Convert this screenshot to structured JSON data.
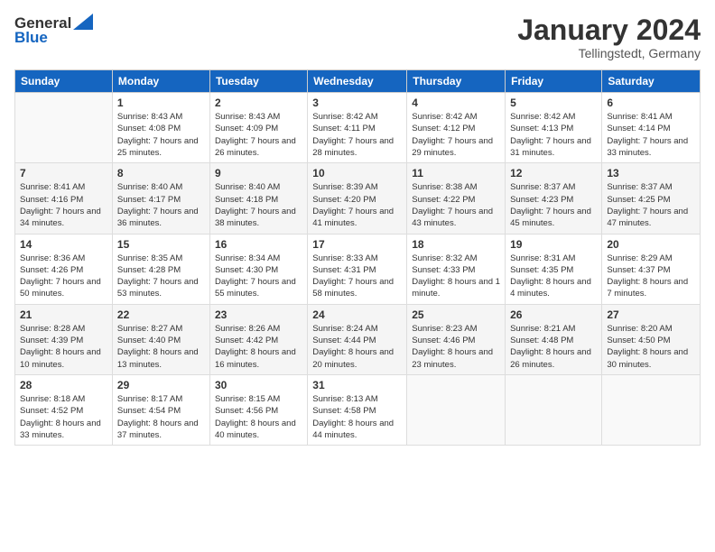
{
  "logo": {
    "general": "General",
    "blue": "Blue"
  },
  "header": {
    "month": "January 2024",
    "location": "Tellingstedt, Germany"
  },
  "days_of_week": [
    "Sunday",
    "Monday",
    "Tuesday",
    "Wednesday",
    "Thursday",
    "Friday",
    "Saturday"
  ],
  "weeks": [
    [
      {
        "day": "",
        "sunrise": "",
        "sunset": "",
        "daylight": ""
      },
      {
        "day": "1",
        "sunrise": "Sunrise: 8:43 AM",
        "sunset": "Sunset: 4:08 PM",
        "daylight": "Daylight: 7 hours and 25 minutes."
      },
      {
        "day": "2",
        "sunrise": "Sunrise: 8:43 AM",
        "sunset": "Sunset: 4:09 PM",
        "daylight": "Daylight: 7 hours and 26 minutes."
      },
      {
        "day": "3",
        "sunrise": "Sunrise: 8:42 AM",
        "sunset": "Sunset: 4:11 PM",
        "daylight": "Daylight: 7 hours and 28 minutes."
      },
      {
        "day": "4",
        "sunrise": "Sunrise: 8:42 AM",
        "sunset": "Sunset: 4:12 PM",
        "daylight": "Daylight: 7 hours and 29 minutes."
      },
      {
        "day": "5",
        "sunrise": "Sunrise: 8:42 AM",
        "sunset": "Sunset: 4:13 PM",
        "daylight": "Daylight: 7 hours and 31 minutes."
      },
      {
        "day": "6",
        "sunrise": "Sunrise: 8:41 AM",
        "sunset": "Sunset: 4:14 PM",
        "daylight": "Daylight: 7 hours and 33 minutes."
      }
    ],
    [
      {
        "day": "7",
        "sunrise": "Sunrise: 8:41 AM",
        "sunset": "Sunset: 4:16 PM",
        "daylight": "Daylight: 7 hours and 34 minutes."
      },
      {
        "day": "8",
        "sunrise": "Sunrise: 8:40 AM",
        "sunset": "Sunset: 4:17 PM",
        "daylight": "Daylight: 7 hours and 36 minutes."
      },
      {
        "day": "9",
        "sunrise": "Sunrise: 8:40 AM",
        "sunset": "Sunset: 4:18 PM",
        "daylight": "Daylight: 7 hours and 38 minutes."
      },
      {
        "day": "10",
        "sunrise": "Sunrise: 8:39 AM",
        "sunset": "Sunset: 4:20 PM",
        "daylight": "Daylight: 7 hours and 41 minutes."
      },
      {
        "day": "11",
        "sunrise": "Sunrise: 8:38 AM",
        "sunset": "Sunset: 4:22 PM",
        "daylight": "Daylight: 7 hours and 43 minutes."
      },
      {
        "day": "12",
        "sunrise": "Sunrise: 8:37 AM",
        "sunset": "Sunset: 4:23 PM",
        "daylight": "Daylight: 7 hours and 45 minutes."
      },
      {
        "day": "13",
        "sunrise": "Sunrise: 8:37 AM",
        "sunset": "Sunset: 4:25 PM",
        "daylight": "Daylight: 7 hours and 47 minutes."
      }
    ],
    [
      {
        "day": "14",
        "sunrise": "Sunrise: 8:36 AM",
        "sunset": "Sunset: 4:26 PM",
        "daylight": "Daylight: 7 hours and 50 minutes."
      },
      {
        "day": "15",
        "sunrise": "Sunrise: 8:35 AM",
        "sunset": "Sunset: 4:28 PM",
        "daylight": "Daylight: 7 hours and 53 minutes."
      },
      {
        "day": "16",
        "sunrise": "Sunrise: 8:34 AM",
        "sunset": "Sunset: 4:30 PM",
        "daylight": "Daylight: 7 hours and 55 minutes."
      },
      {
        "day": "17",
        "sunrise": "Sunrise: 8:33 AM",
        "sunset": "Sunset: 4:31 PM",
        "daylight": "Daylight: 7 hours and 58 minutes."
      },
      {
        "day": "18",
        "sunrise": "Sunrise: 8:32 AM",
        "sunset": "Sunset: 4:33 PM",
        "daylight": "Daylight: 8 hours and 1 minute."
      },
      {
        "day": "19",
        "sunrise": "Sunrise: 8:31 AM",
        "sunset": "Sunset: 4:35 PM",
        "daylight": "Daylight: 8 hours and 4 minutes."
      },
      {
        "day": "20",
        "sunrise": "Sunrise: 8:29 AM",
        "sunset": "Sunset: 4:37 PM",
        "daylight": "Daylight: 8 hours and 7 minutes."
      }
    ],
    [
      {
        "day": "21",
        "sunrise": "Sunrise: 8:28 AM",
        "sunset": "Sunset: 4:39 PM",
        "daylight": "Daylight: 8 hours and 10 minutes."
      },
      {
        "day": "22",
        "sunrise": "Sunrise: 8:27 AM",
        "sunset": "Sunset: 4:40 PM",
        "daylight": "Daylight: 8 hours and 13 minutes."
      },
      {
        "day": "23",
        "sunrise": "Sunrise: 8:26 AM",
        "sunset": "Sunset: 4:42 PM",
        "daylight": "Daylight: 8 hours and 16 minutes."
      },
      {
        "day": "24",
        "sunrise": "Sunrise: 8:24 AM",
        "sunset": "Sunset: 4:44 PM",
        "daylight": "Daylight: 8 hours and 20 minutes."
      },
      {
        "day": "25",
        "sunrise": "Sunrise: 8:23 AM",
        "sunset": "Sunset: 4:46 PM",
        "daylight": "Daylight: 8 hours and 23 minutes."
      },
      {
        "day": "26",
        "sunrise": "Sunrise: 8:21 AM",
        "sunset": "Sunset: 4:48 PM",
        "daylight": "Daylight: 8 hours and 26 minutes."
      },
      {
        "day": "27",
        "sunrise": "Sunrise: 8:20 AM",
        "sunset": "Sunset: 4:50 PM",
        "daylight": "Daylight: 8 hours and 30 minutes."
      }
    ],
    [
      {
        "day": "28",
        "sunrise": "Sunrise: 8:18 AM",
        "sunset": "Sunset: 4:52 PM",
        "daylight": "Daylight: 8 hours and 33 minutes."
      },
      {
        "day": "29",
        "sunrise": "Sunrise: 8:17 AM",
        "sunset": "Sunset: 4:54 PM",
        "daylight": "Daylight: 8 hours and 37 minutes."
      },
      {
        "day": "30",
        "sunrise": "Sunrise: 8:15 AM",
        "sunset": "Sunset: 4:56 PM",
        "daylight": "Daylight: 8 hours and 40 minutes."
      },
      {
        "day": "31",
        "sunrise": "Sunrise: 8:13 AM",
        "sunset": "Sunset: 4:58 PM",
        "daylight": "Daylight: 8 hours and 44 minutes."
      },
      {
        "day": "",
        "sunrise": "",
        "sunset": "",
        "daylight": ""
      },
      {
        "day": "",
        "sunrise": "",
        "sunset": "",
        "daylight": ""
      },
      {
        "day": "",
        "sunrise": "",
        "sunset": "",
        "daylight": ""
      }
    ]
  ]
}
